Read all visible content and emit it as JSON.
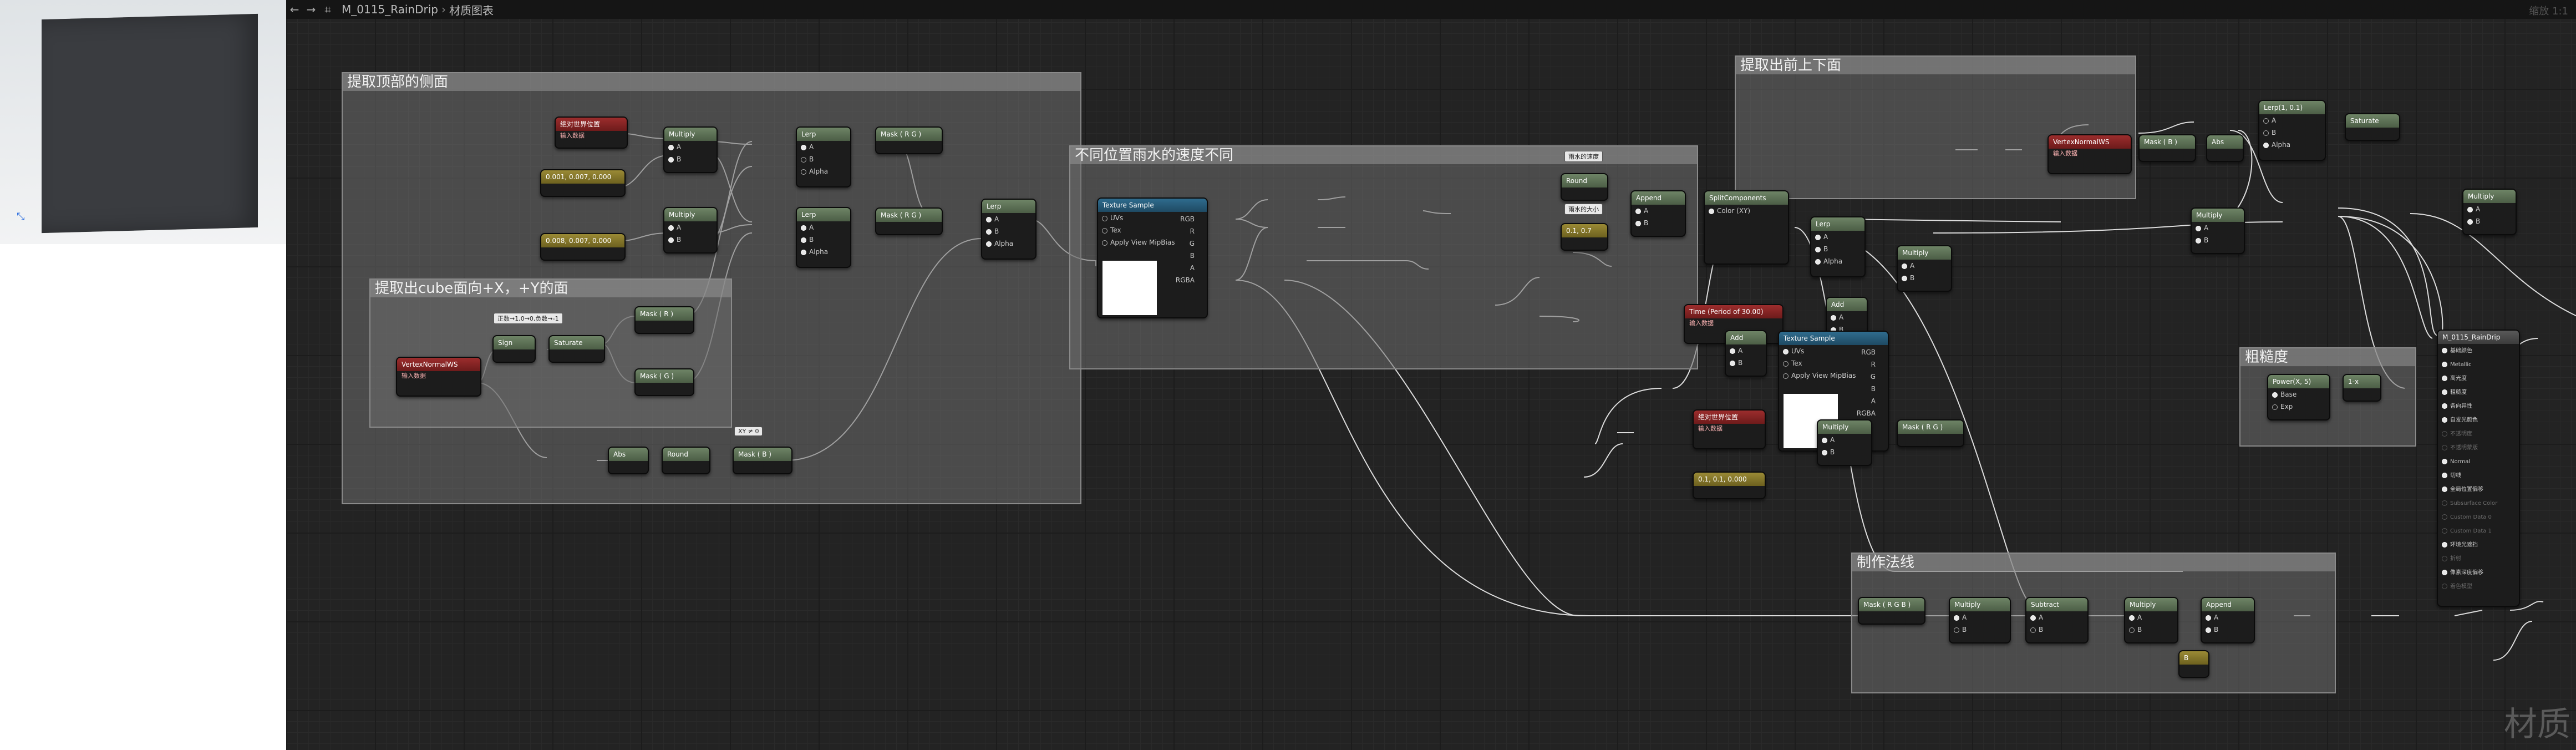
{
  "breadcrumb": {
    "asset": "M_0115_RainDrip",
    "page": "材质图表"
  },
  "comments": {
    "c1": "提取顶部的侧面",
    "c2": "提取出cube面向+X，+Y的面",
    "c3": "不同位置雨水的速度不同",
    "c4": "提取出前上下面",
    "c5": "粗糙度",
    "c6": "制作法线"
  },
  "nodes": {
    "absworldpos1": "绝对世界位置",
    "absworldpos1_sub": "输入数据",
    "const_a": "0.001, 0.007, 0.000",
    "const_b": "0.008, 0.007, 0.000",
    "multiply": "Multiply",
    "lerp": "Lerp",
    "mask_rg": "Mask ( R G )",
    "vertexnormal": "VertexNormalWS",
    "vertexnormal_sub": "输入数据",
    "comment_tag": "正数→1,0→0,负数→-1",
    "sign": "Sign",
    "saturate": "Saturate",
    "mask_r": "Mask ( R )",
    "mask_g": "Mask ( G )",
    "mask_b": "Mask ( B )",
    "abs": "Abs",
    "round": "Round",
    "tag_xy": "XY ≠ 0",
    "texture_sample": "Texture Sample",
    "tag_speed": "雨水的速度",
    "tag_size": "雨水的大小",
    "append": "Append",
    "splitcomponents": "SplitComponents",
    "colorxyz": "Color (XY)",
    "time": "Time (Period of 30.00)",
    "time_sub": "输入数据",
    "add": "Add",
    "absworldpos2": "绝对世界位置",
    "absworldpos2_sub": "输入数据",
    "const_c": "0.1, 0.1, 0.000",
    "const_d": "0.1, 0.7",
    "mask_rgb": "Mask ( R G B )",
    "subtract": "Subtract",
    "lerp_r": "Lerp(1, 0.1)",
    "power": "Power(X, 5)",
    "one_minus": "1-x",
    "tag_b": "B",
    "result_title": "M_0115_RainDrip"
  },
  "pins": {
    "uvs": "UVs",
    "tex": "Tex",
    "apply_mip": "Apply View MipBias",
    "rgb": "RGB",
    "r": "R",
    "g": "G",
    "b": "B",
    "a": "A",
    "rgba": "RGBA",
    "pa": "A",
    "pb": "B",
    "alpha": "Alpha",
    "base": "Base",
    "exp": "Exp"
  },
  "result_pins": [
    {
      "label": "基础颜色",
      "active": true
    },
    {
      "label": "Metallic",
      "active": true
    },
    {
      "label": "高光度",
      "active": true
    },
    {
      "label": "粗糙度",
      "active": true
    },
    {
      "label": "各向异性",
      "active": true
    },
    {
      "label": "自发光颜色",
      "active": true
    },
    {
      "label": "不透明度",
      "active": false
    },
    {
      "label": "不透明蒙版",
      "active": false
    },
    {
      "label": "Normal",
      "active": true
    },
    {
      "label": "切线",
      "active": true
    },
    {
      "label": "全局位置偏移",
      "active": true
    },
    {
      "label": "Subsurface Color",
      "active": false
    },
    {
      "label": "Custom Data 0",
      "active": false
    },
    {
      "label": "Custom Data 1",
      "active": false
    },
    {
      "label": "环境光遮挡",
      "active": true
    },
    {
      "label": "折射",
      "active": false
    },
    {
      "label": "像素深度偏移",
      "active": true
    },
    {
      "label": "着色模型",
      "active": false
    }
  ],
  "watermark": "材质",
  "zoom": "缩放 1:1"
}
